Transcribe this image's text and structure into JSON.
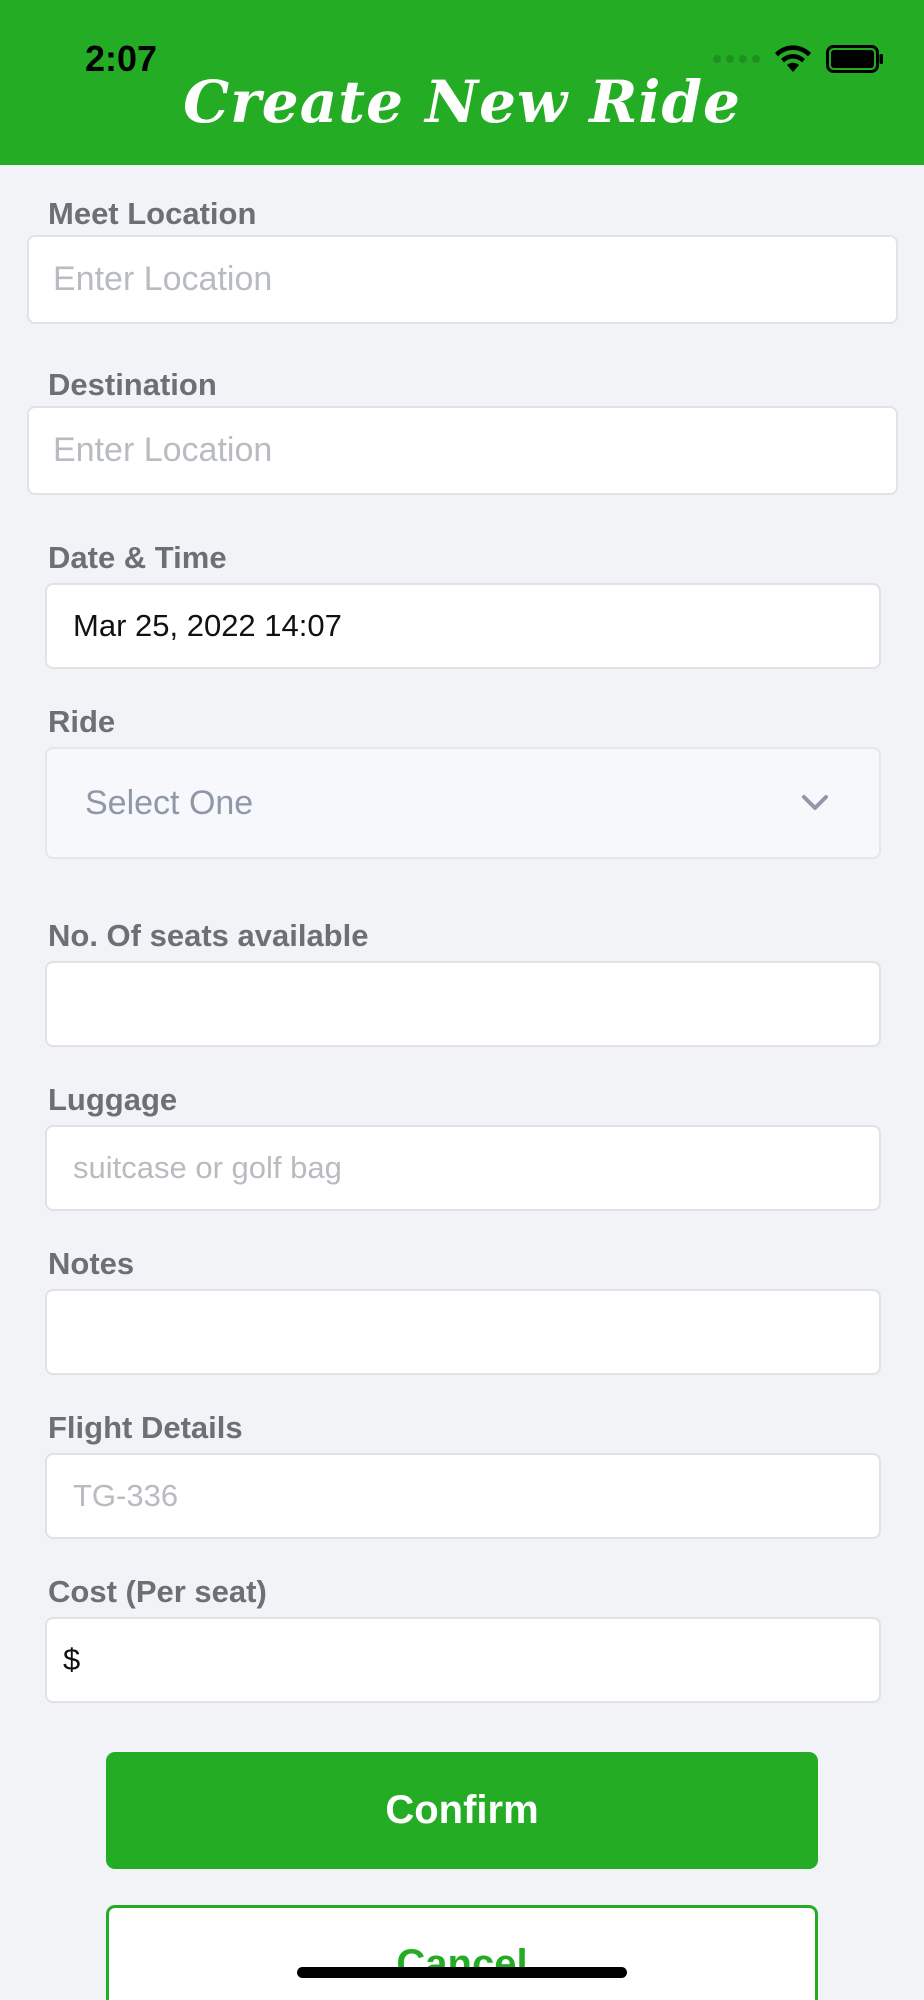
{
  "status_bar": {
    "time": "2:07"
  },
  "header": {
    "title": "Create New Ride"
  },
  "form": {
    "meet_location": {
      "label": "Meet Location",
      "placeholder": "Enter Location"
    },
    "destination": {
      "label": "Destination",
      "placeholder": "Enter Location"
    },
    "date_time": {
      "label": "Date & Time",
      "value": "Mar 25, 2022 14:07"
    },
    "ride": {
      "label": "Ride",
      "selected": "Select One"
    },
    "seats": {
      "label": "No. Of seats available",
      "value": ""
    },
    "luggage": {
      "label": "Luggage",
      "placeholder": "suitcase or golf bag"
    },
    "notes": {
      "label": "Notes",
      "value": ""
    },
    "flight": {
      "label": "Flight Details",
      "placeholder": "TG-336"
    },
    "cost": {
      "label": "Cost (Per seat)",
      "value": "$"
    }
  },
  "actions": {
    "confirm_label": "Confirm",
    "cancel_label": "Cancel"
  },
  "colors": {
    "brand_green": "#24ad24",
    "background": "#f2f3f7"
  }
}
